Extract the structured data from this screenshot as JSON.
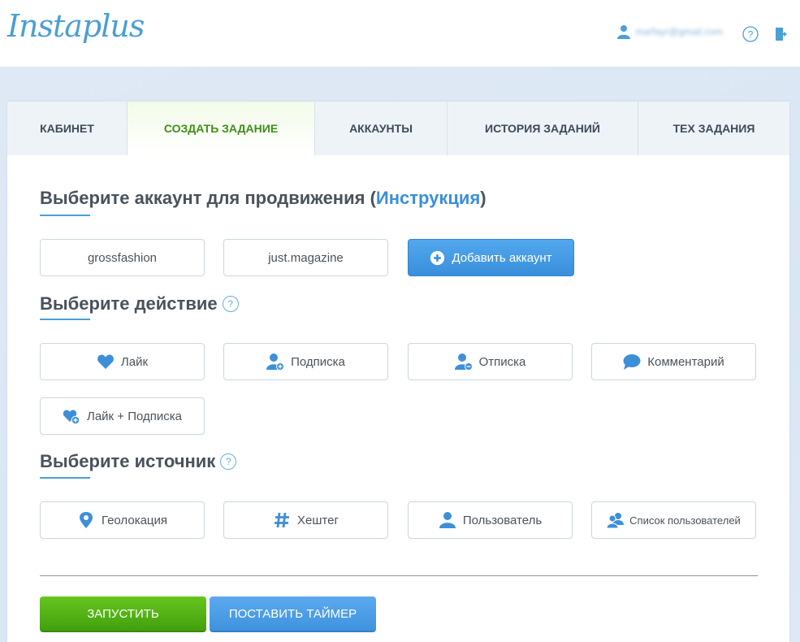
{
  "header": {
    "logo": "Instaplus",
    "user_email": "marfayr@gmail.com"
  },
  "tabs": [
    {
      "label": "КАБИНЕТ",
      "active": false
    },
    {
      "label": "СОЗДАТЬ ЗАДАНИЕ",
      "active": true
    },
    {
      "label": "АККАУНТЫ",
      "active": false
    },
    {
      "label": "ИСТОРИЯ ЗАДАНИЙ",
      "active": false
    },
    {
      "label": "ТЕХ ЗАДАНИЯ",
      "active": false
    }
  ],
  "account_section": {
    "title_prefix": "Выберите аккаунт для продвижения (",
    "title_link": "Инструкция",
    "title_suffix": ")",
    "accounts": [
      "grossfashion",
      "just.magazine"
    ],
    "add_label": "Добавить аккаунт"
  },
  "action_section": {
    "title": "Выберите действие",
    "help": "?",
    "actions": [
      {
        "label": "Лайк",
        "icon": "heart-icon"
      },
      {
        "label": "Подписка",
        "icon": "user-plus-icon"
      },
      {
        "label": "Отписка",
        "icon": "user-minus-icon"
      },
      {
        "label": "Комментарий",
        "icon": "comment-icon"
      },
      {
        "label": "Лайк + Подписка",
        "icon": "heart-plus-icon"
      }
    ]
  },
  "source_section": {
    "title": "Выберите источник",
    "help": "?",
    "sources": [
      {
        "label": "Геолокация",
        "icon": "location-pin-icon"
      },
      {
        "label": "Хештег",
        "icon": "hashtag-icon"
      },
      {
        "label": "Пользователь",
        "icon": "user-icon"
      },
      {
        "label": "Список пользователей",
        "icon": "users-icon"
      }
    ]
  },
  "footer_buttons": {
    "start": "ЗАПУСТИТЬ",
    "timer": "ПОСТАВИТЬ ТАЙМЕР"
  },
  "colors": {
    "accent_blue": "#3b8fd9",
    "active_tab_green": "#3f8e16",
    "start_green": "#52b515"
  }
}
